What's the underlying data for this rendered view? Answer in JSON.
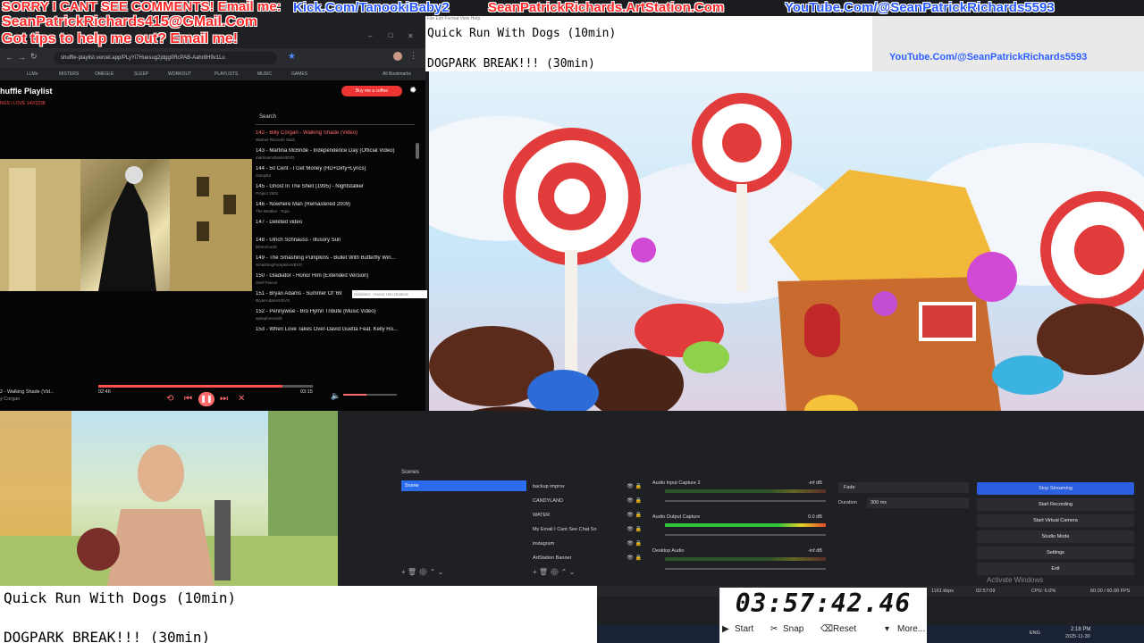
{
  "banner": {
    "line1": "SORRY I CANT SEE COMMENTS! Email me:",
    "line2": "SeanPatrickRichards415@GMail.Com",
    "line3": "Got tips to help me out? Email me!",
    "kick": "Kick.Com/TanookiBaby2",
    "artstation": "SeanPatrickRichards.ArtStation.Com",
    "youtube": "YouTube.Com/@SeanPatrickRichards5593",
    "youtube_small": "YouTube.Com/@SeanPatrickRichards5593"
  },
  "browser": {
    "url": "shuffle-playlist.vercel.app/PLyYi7Huesug2jdgg0RcPAB-Aahr8H9v1Lu",
    "bookmarks": [
      "LLMs",
      "MISTERS",
      "OMEGLE",
      "SLEEP",
      "WORKOUT",
      "PLAYLISTS",
      "MUSIC",
      "GAMES",
      "All Bookmarks"
    ],
    "page_title": "huffle Playlist",
    "page_subtitle": "NGS I LOVE  142/2238",
    "coffee_button": "Buy me a coffee",
    "search_label": "Search",
    "songs": [
      {
        "title": "142 - Billy Corgan - Walking Shade (Video)",
        "artist": "Warner Records Vault",
        "active": true
      },
      {
        "title": "143 - Martina McBride - Independence Day (Official Video)",
        "artist": "martinamcbrideVEVO",
        "active": false
      },
      {
        "title": "144 - 50 Cent - I Get Money (HD+Dirty+Lyrics)",
        "artist": "Gangsta",
        "active": false
      },
      {
        "title": "145 - Ghost In The Shell (1995) - Nightstalker",
        "artist": "Project 2501",
        "active": false
      },
      {
        "title": "146 - Nowhere Man (Remastered 2009)",
        "artist": "The Beatles - Topic",
        "active": false
      },
      {
        "title": "147 - Deleted video",
        "artist": "",
        "active": false
      },
      {
        "title": "148 - Ulrich Schnauss - Illusory Sun",
        "artist": "blimmmuzik",
        "active": false
      },
      {
        "title": "149 - The Smashing Pumpkins - Bullet With Butterfly Win...",
        "artist": "SmashingPumpkinsVEVO",
        "active": false
      },
      {
        "title": "150 - Gladiator - Honor Him (Extended Version)",
        "artist": "Geril Flacon",
        "active": false
      },
      {
        "title": "151 - Bryan Adams - Summer Of '69",
        "artist": "BryanAdamsVEVO",
        "active": false
      },
      {
        "title": "152 - Pennywise - Bro Hymn Tribute (Music Video)",
        "artist": "epitaphrecords",
        "active": false
      },
      {
        "title": "153 - When Love Takes Over-David Guetta Feat. Kelly Ro...",
        "artist": "",
        "active": false
      }
    ],
    "tooltip": "Gladiator - Honor Him (Extend",
    "now_playing": "2 - Walking Shade (Vid...",
    "now_artist": "y Corgan",
    "time_current": "02:46",
    "time_total": "03:15",
    "progress": 0.86
  },
  "notes": {
    "line1": "Quick Run With Dogs (10min)",
    "line2": "DOGPARK BREAK!!! (30min)",
    "menu": "File  Edit  Format  View  Help"
  },
  "obs": {
    "scenes_title": "Scenes",
    "scene_selected": "Scene",
    "sources": [
      "backup improv",
      "CANDYLAND",
      "WATER",
      "My Email I Cant See Chat So",
      "instagram",
      "ArtStation Banner"
    ],
    "mixer": [
      {
        "name": "Audio Input Capture 2",
        "db": "-inf dB",
        "hot": false
      },
      {
        "name": "Audio Output Capture",
        "db": "0.0 dB",
        "hot": true
      },
      {
        "name": "Desktop Audio",
        "db": "-inf dB",
        "hot": false
      }
    ],
    "transition": "Fade",
    "duration_label": "Duration",
    "duration_value": "300 ms",
    "controls": [
      "Stop Streaming",
      "Start Recording",
      "Start Virtual Camera",
      "Studio Mode",
      "Settings",
      "Exit"
    ],
    "status_kbps": "1161 kbps",
    "status_time": "02:57:09",
    "status_cpu": "CPU: 6.0%",
    "status_fps": "60.00 / 60.00 FPS",
    "activate": "Activate Windows"
  },
  "timer": {
    "value": "03:57:42.46",
    "start": "Start",
    "snap": "Snap",
    "reset": "Reset",
    "more": "More..."
  },
  "clock": {
    "time": "2:18 PM",
    "date": "2025-11-30"
  },
  "tray": {
    "lang": "ENG"
  }
}
